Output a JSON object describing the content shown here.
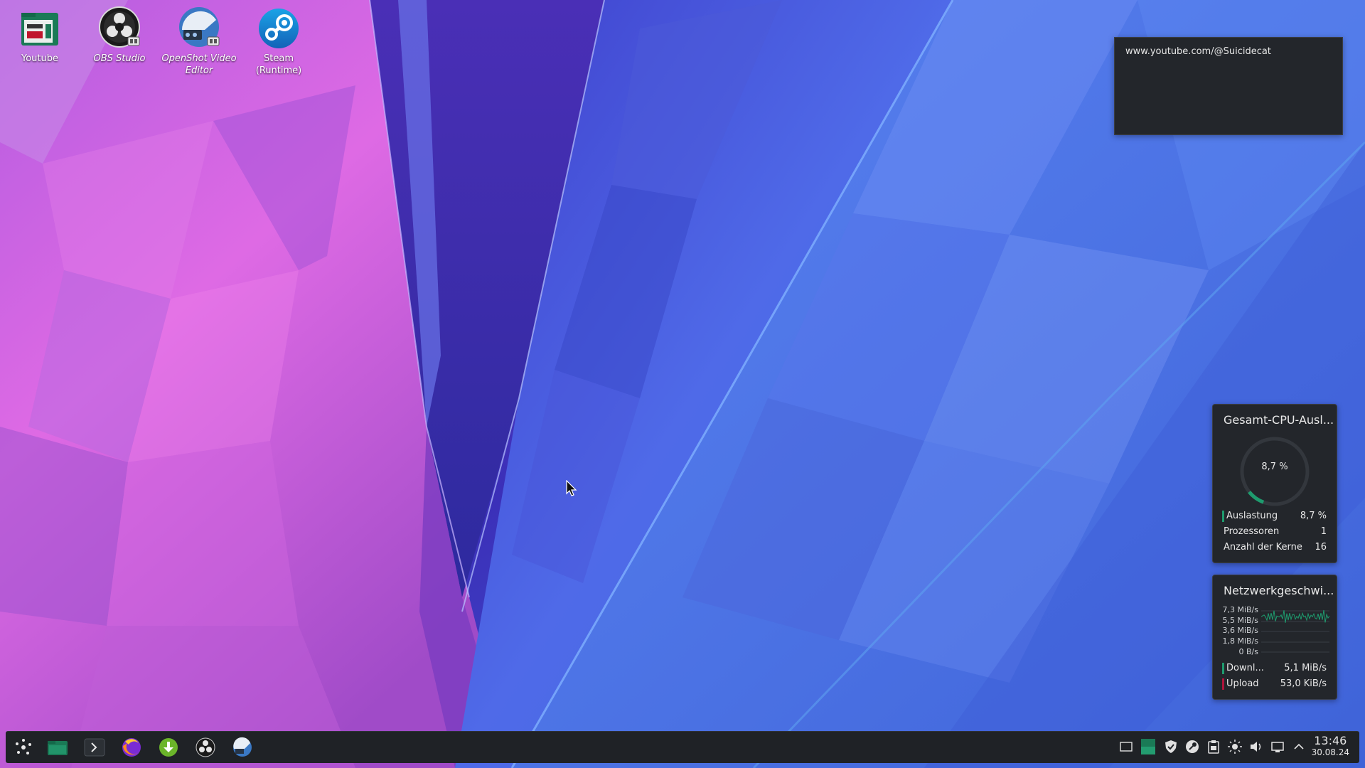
{
  "desktop": {
    "icons": [
      {
        "label": "Youtube",
        "icon": "folder-icon"
      },
      {
        "label": "OBS Studio",
        "icon": "obs-studio-icon"
      },
      {
        "label": "OpenShot Video Editor",
        "icon": "openshot-icon"
      },
      {
        "label": "Steam (Runtime)",
        "icon": "steam-icon"
      }
    ]
  },
  "note": {
    "text": "www.youtube.com/@Suicidecat"
  },
  "cpu_widget": {
    "title": "Gesamt-CPU-Ausl...",
    "gauge_value": "8,7 %",
    "load_fraction": 0.087,
    "accent": "#1e9b6e",
    "rows": [
      {
        "label": "Auslastung",
        "value": "8,7 %"
      },
      {
        "label": "Prozessoren",
        "value": "1"
      },
      {
        "label": "Anzahl der Kerne",
        "value": "16"
      }
    ]
  },
  "net_widget": {
    "title": "Netzwerkgeschwi...",
    "y_labels": [
      "7,3 MiB/s",
      "5,5 MiB/s",
      "3,6 MiB/s",
      "1,8 MiB/s",
      "0 B/s"
    ],
    "rows": [
      {
        "label": "Downl...",
        "value": "5,1 MiB/s",
        "color": "#1e9b6e"
      },
      {
        "label": "Upload",
        "value": "53,0 KiB/s",
        "color": "#b0143c"
      }
    ]
  },
  "taskbar": {
    "launchers": [
      "application-launcher-icon",
      "file-manager-icon",
      "terminal-icon",
      "firefox-icon",
      "download-manager-icon",
      "obs-studio-icon",
      "openshot-icon"
    ],
    "tray": [
      "show-desktop-icon",
      "pager-icon",
      "shield-icon",
      "steam-icon",
      "clipboard-icon",
      "brightness-icon",
      "volume-icon",
      "network-icon",
      "expand-tray-icon"
    ],
    "clock_time": "13:46",
    "clock_date": "30.08.24"
  }
}
